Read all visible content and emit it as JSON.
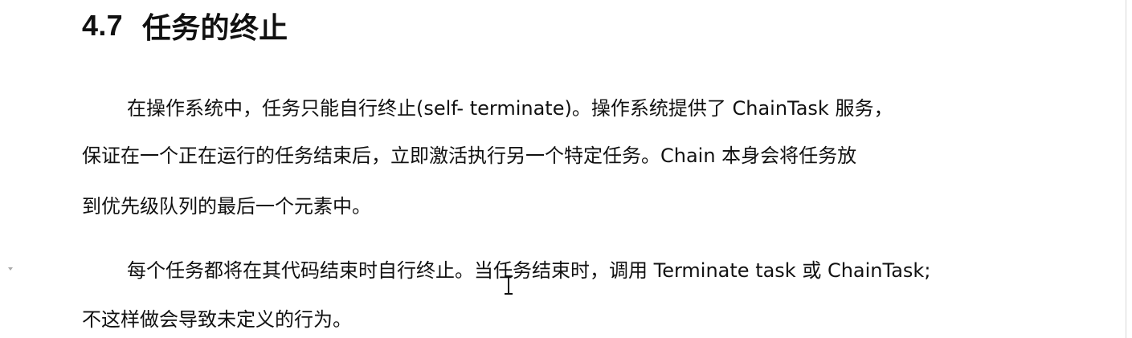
{
  "document": {
    "heading": {
      "number": "4.7",
      "title": "任务的终止"
    },
    "paragraphs": [
      {
        "lines": [
          "在操作系统中，任务只能自行终止(self- terminate)。操作系统提供了 ChainTask 服务，",
          "保证在一个正在运行的任务结束后，立即激活执行另一个特定任务。Chain 本身会将任务放",
          "到优先级队列的最后一个元素中。"
        ]
      },
      {
        "lines": [
          "每个任务都将在其代码结束时自行终止。当任务结束时，调用 Terminate task 或 ChainTask;",
          "不这样做会导致未定义的行为。"
        ]
      }
    ]
  }
}
